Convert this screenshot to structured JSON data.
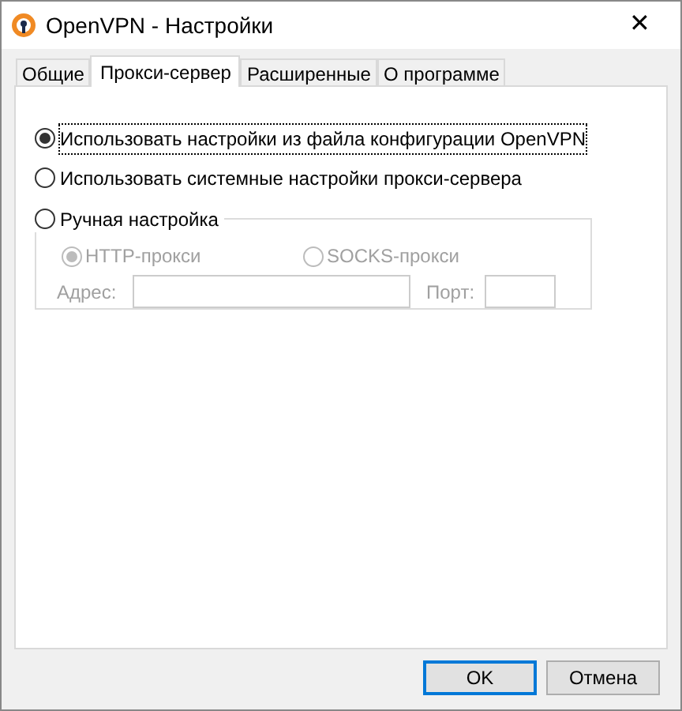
{
  "window": {
    "title": "OpenVPN - Настройки",
    "close": "✕"
  },
  "tabs": [
    {
      "label": "Общие",
      "selected": false
    },
    {
      "label": "Прокси-сервер",
      "selected": true
    },
    {
      "label": "Расширенные",
      "selected": false
    },
    {
      "label": "О программе",
      "selected": false
    }
  ],
  "proxy_options": [
    {
      "label": "Использовать настройки из файла конфигурации OpenVPN",
      "selected": true,
      "focused": true
    },
    {
      "label": "Использовать системные настройки прокси-сервера",
      "selected": false,
      "focused": false
    },
    {
      "label": "Ручная настройка",
      "selected": false,
      "focused": false
    }
  ],
  "manual": {
    "disabled": true,
    "types": [
      {
        "label": "HTTP-прокси",
        "selected": true
      },
      {
        "label": "SOCKS-прокси",
        "selected": false
      }
    ],
    "address_label": "Адрес:",
    "port_label": "Порт:"
  },
  "buttons": [
    {
      "label": "OK",
      "default": true
    },
    {
      "label": "Отмена",
      "default": false
    }
  ]
}
